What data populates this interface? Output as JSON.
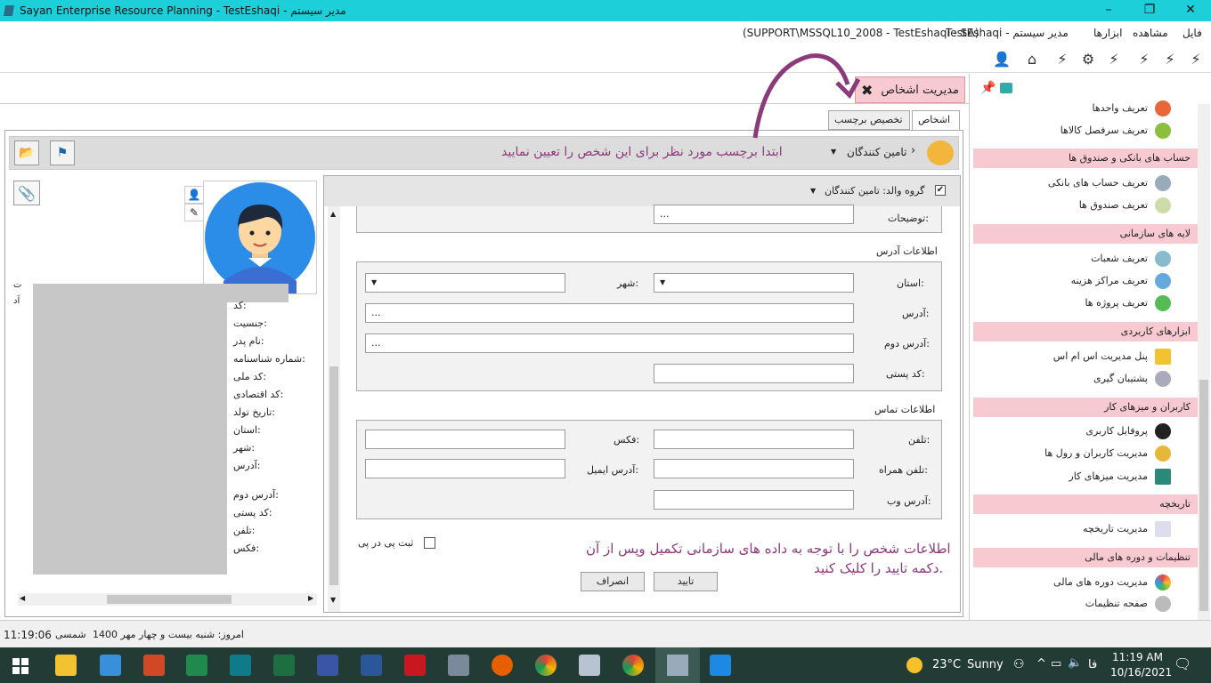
{
  "window": {
    "title": "Sayan Enterprise Resource Planning - TestEshaqi - مدیر سیستم"
  },
  "menu": {
    "items": [
      "فایل",
      "مشاهده",
      "ابزارها",
      "TestEshaqi - مدیر سیستم"
    ],
    "connection": "(SUPPORT\\MSSQL10_2008 - TestEshaqi - SA)"
  },
  "document_tab": {
    "label": "مدیریت اشخاص"
  },
  "inner_tabs": {
    "persons": "اشخاص",
    "assign_label": "تخصیص برچسب"
  },
  "header": {
    "category": "تامین کنندگان",
    "hint": "ابتدا برچسب مورد نظر برای این شخص را تعیین نمایید"
  },
  "parent_group": {
    "label": "گروه والد: تامین کنندگان",
    "checked": true
  },
  "form": {
    "description_label": "توضیحات:",
    "description_value": "...",
    "address_group": "اطلاعات آدرس",
    "province_label": "استان:",
    "city_label": "شهر:",
    "address_label": "آدرس:",
    "address_value": "...",
    "address2_label": "آدرس دوم:",
    "address2_value": "...",
    "postal_label": "کد پستی:",
    "contact_group": "اطلاعات تماس",
    "phone_label": "تلفن:",
    "fax_label": "فکس:",
    "mobile_label": "تلفن همراه:",
    "email_label": "آدرس ایمیل:",
    "web_label": "آدرس وب:",
    "repeat_label": "ثبت پی در پی",
    "confirm_button": "تایید",
    "cancel_button": "انصراف"
  },
  "annotation": {
    "line1": "اطلاعات شخص را با توجه به داده های سازمانی تکمیل وپس از آن",
    "line2": "دکمه تایید را کلیک کنید."
  },
  "summary_fields": [
    "کد:",
    "جنسیت:",
    "نام پدر:",
    "شماره شناسنامه:",
    "کد ملی:",
    "کد اقتصادی:",
    "تاریخ تولد:",
    "استان:",
    "شهر:",
    "آدرس:",
    "آدرس دوم:",
    "کد پستی:",
    "تلفن:",
    "فکس:"
  ],
  "left_edge_chars": [
    "ت",
    "آد"
  ],
  "sidebar": {
    "sections": [
      {
        "title": "",
        "items": [
          "تعریف واحدها",
          "تعریف سرفصل کالاها"
        ]
      },
      {
        "title": "حساب های بانکی و صندوق ها",
        "items": [
          "تعریف حساب های بانکی",
          "تعریف صندوق ها"
        ]
      },
      {
        "title": "لایه های سازمانی",
        "items": [
          "تعریف شعبات",
          "تعریف مراکز هزینه",
          "تعریف پروژه ها"
        ]
      },
      {
        "title": "ابزارهای کاربردی",
        "items": [
          "پنل مدیریت اس ام اس",
          "پشتیبان گیری"
        ]
      },
      {
        "title": "کاربران و میزهای کار",
        "items": [
          "پروفایل کاربری",
          "مدیریت کاربران و رول ها",
          "مدیریت میزهای کار"
        ]
      },
      {
        "title": "تاریخچه",
        "items": [
          "مدیریت تاریخچه"
        ]
      },
      {
        "title": "تنظیمات و دوره های مالی",
        "items": [
          "مدیریت دوره های مالی",
          "صفحه تنظیمات"
        ]
      }
    ]
  },
  "status": {
    "time": "11:19:06",
    "calendar": "شمسی",
    "today": "امروز: شنبه بیست و چهار مهر 1400"
  },
  "taskbar": {
    "weather_temp": "23°C",
    "weather_text": "Sunny",
    "lang": "فا",
    "clock_time": "11:19 AM",
    "clock_date": "10/16/2021"
  },
  "colors": {
    "titlebar": "#1ccfd9",
    "accent_pink": "#f7c9d0",
    "annotation": "#8b3a7a",
    "taskbar": "#233b35"
  }
}
